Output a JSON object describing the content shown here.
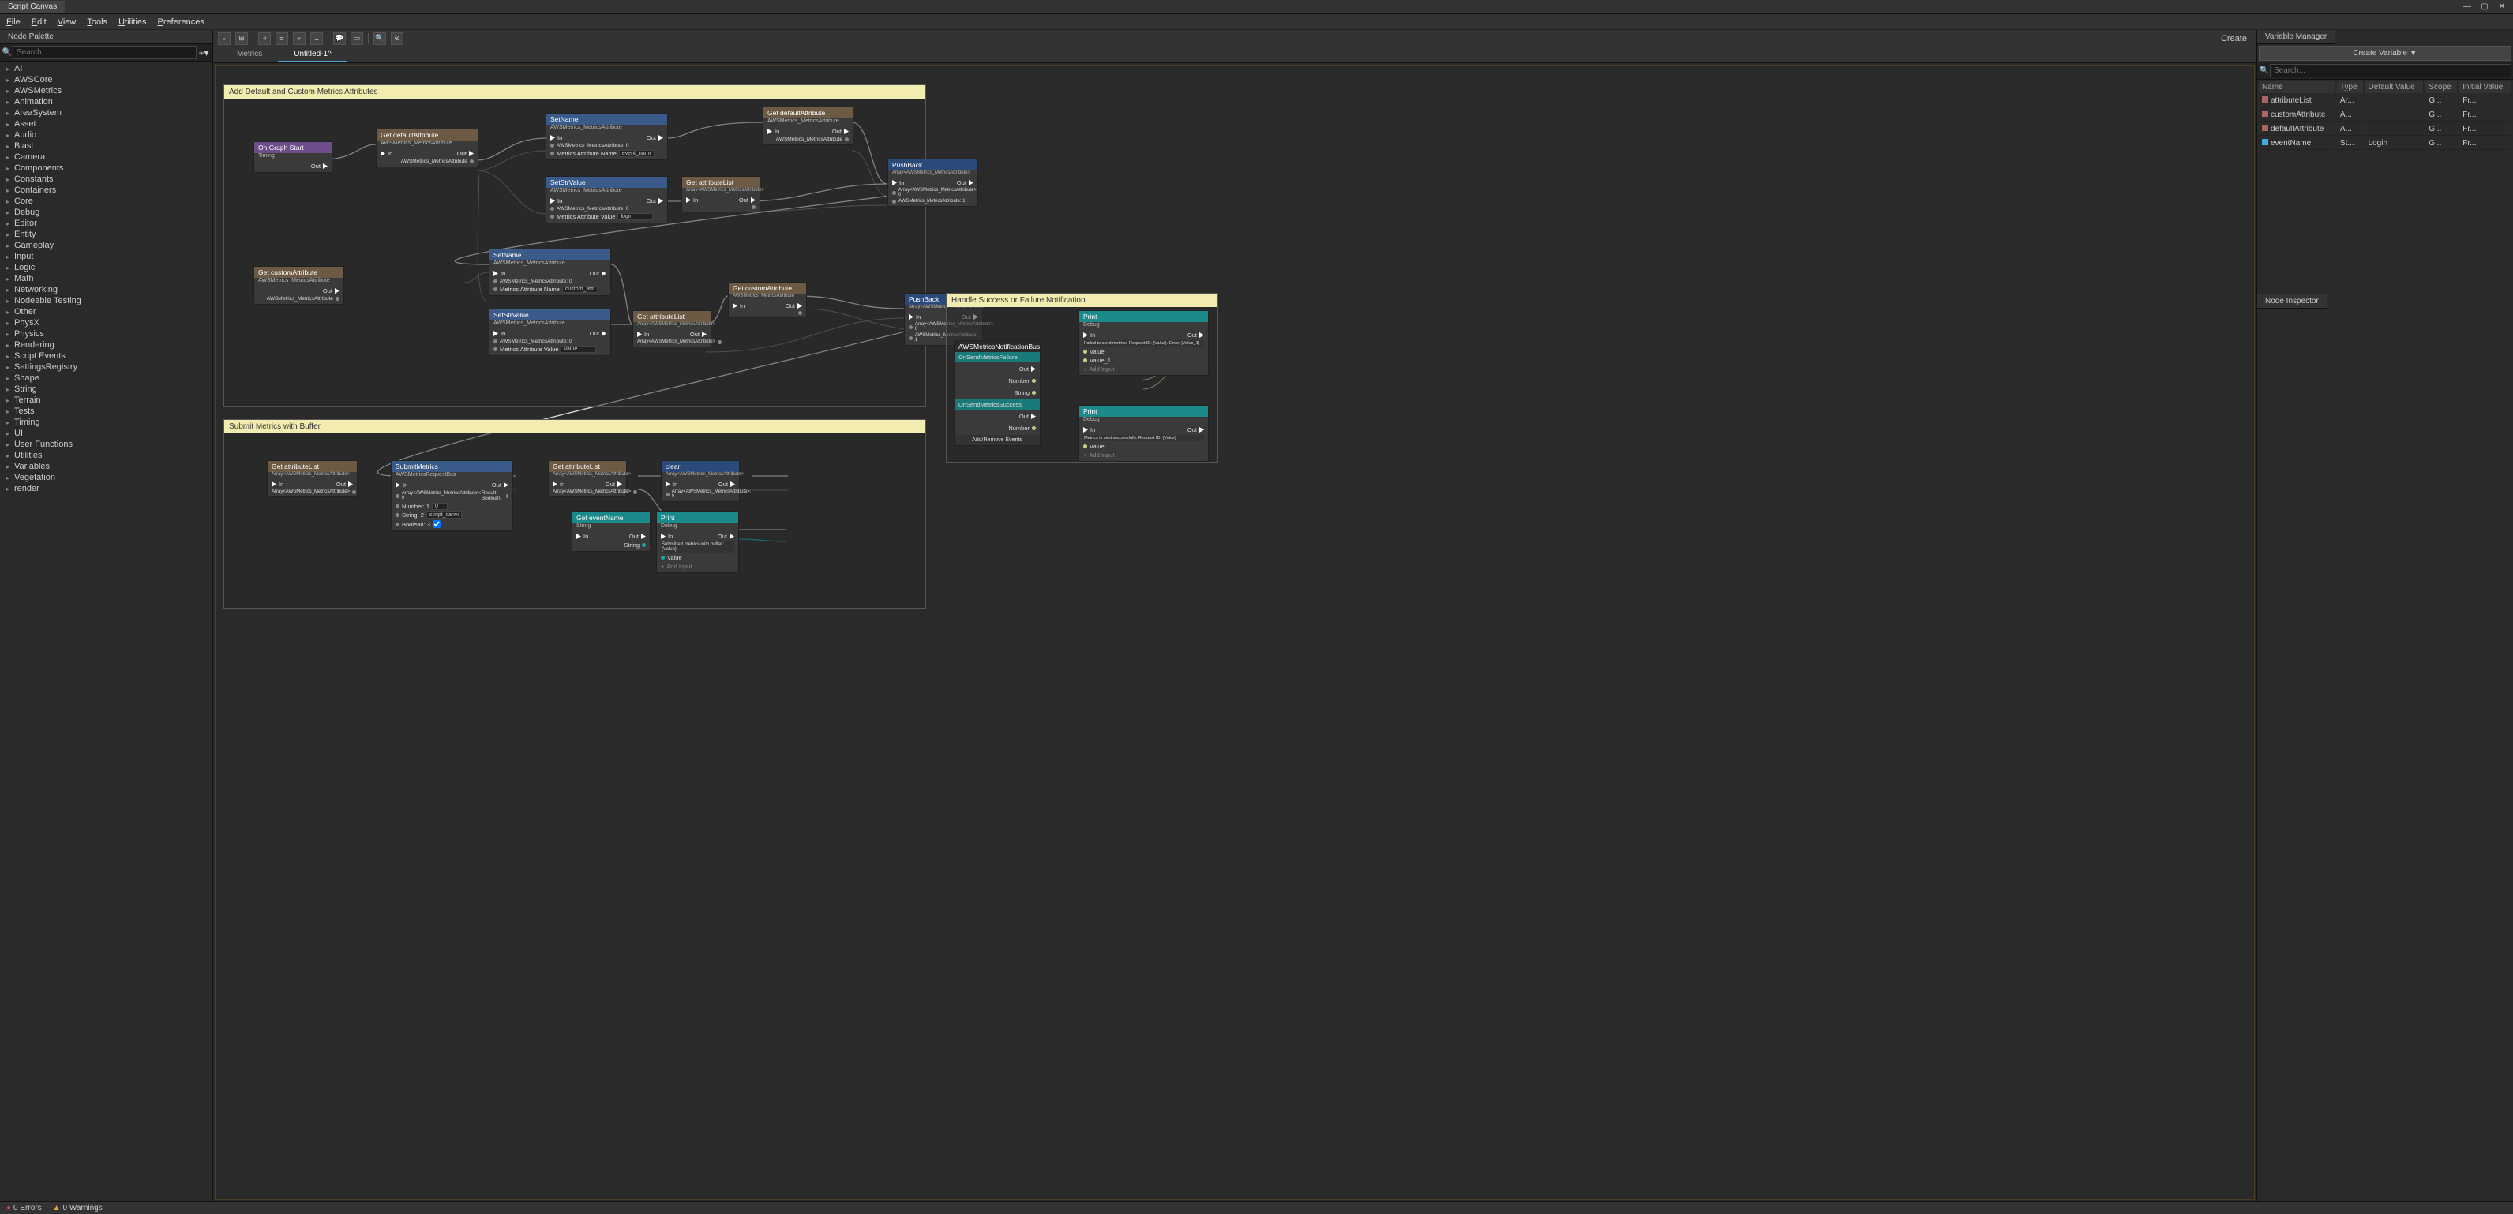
{
  "app": {
    "title": "Script Canvas"
  },
  "window_buttons": {
    "min": "—",
    "max": "▢",
    "close": "✕"
  },
  "menu": [
    "File",
    "Edit",
    "View",
    "Tools",
    "Utilities",
    "Preferences"
  ],
  "palette": {
    "title": "Node Palette",
    "search_placeholder": "Search...",
    "categories": [
      "AI",
      "AWSCore",
      "AWSMetrics",
      "Animation",
      "AreaSystem",
      "Asset",
      "Audio",
      "Blast",
      "Camera",
      "Components",
      "Constants",
      "Containers",
      "Core",
      "Debug",
      "Editor",
      "Entity",
      "Gameplay",
      "Input",
      "Logic",
      "Math",
      "Networking",
      "Nodeable Testing",
      "Other",
      "PhysX",
      "Physics",
      "Rendering",
      "Script Events",
      "SettingsRegistry",
      "Shape",
      "String",
      "Terrain",
      "Tests",
      "Timing",
      "UI",
      "User Functions",
      "Utilities",
      "Variables",
      "Vegetation",
      "render"
    ]
  },
  "toolbar": {
    "create": "Create"
  },
  "tabs": [
    {
      "label": "Metrics",
      "active": false
    },
    {
      "label": "Untitled-1^",
      "active": true
    }
  ],
  "groups": {
    "g1": {
      "title": "Add Default and Custom Metrics Attributes"
    },
    "g2": {
      "title": "Submit Metrics with Buffer"
    },
    "g3": {
      "title": "Handle Success or Failure Notification"
    }
  },
  "nodes": {
    "onstart": {
      "title": "On Graph Start",
      "sub": "Timing"
    },
    "getdef1": {
      "title": "Get defaultAttribute",
      "sub": "AWSMetrics_MetricsAttribute"
    },
    "getdef2": {
      "title": "Get defaultAttribute",
      "sub": "AWSMetrics_MetricsAttribute"
    },
    "setname1": {
      "title": "SetName",
      "sub": "AWSMetrics_MetricsAttribute",
      "field_lbl": "Metrics Attribute Name",
      "field_val": "event_name"
    },
    "setstr1": {
      "title": "SetStrValue",
      "sub": "AWSMetrics_MetricsAttribute",
      "field_lbl": "Metrics Attribute Value",
      "field_val": "login"
    },
    "getattr1": {
      "title": "Get attributeList",
      "sub": "Array<AWSMetrics_MetricsAttribute>"
    },
    "pushback1": {
      "title": "PushBack",
      "sub": "Array<AWSMetrics_MetricsAttribute>"
    },
    "getcust1": {
      "title": "Get customAttribute",
      "sub": "AWSMetrics_MetricsAttribute"
    },
    "setname2": {
      "title": "SetName",
      "sub": "AWSMetrics_MetricsAttribute",
      "field_lbl": "Metrics Attribute Name",
      "field_val": "custom_attribute"
    },
    "setstr2": {
      "title": "SetStrValue",
      "sub": "AWSMetrics_MetricsAttribute",
      "field_lbl": "Metrics Attribute Value",
      "field_val": "value"
    },
    "getattr2": {
      "title": "Get attributeList",
      "sub": "Array<AWSMetrics_MetricsAttribute>"
    },
    "getcust2": {
      "title": "Get customAttribute",
      "sub": "AWSMetrics_MetricsAttribute"
    },
    "pushback2": {
      "title": "PushBack",
      "sub": "Array<AWSMetrics_MetricsAttribute>"
    },
    "getattr3": {
      "title": "Get attributeList",
      "sub": "Array<AWSMetrics_MetricsAttribute>"
    },
    "submit": {
      "title": "SubmitMetrics",
      "sub": "AWSMetricsRequestBus",
      "num_lbl": "Number: 1",
      "num_val": "0",
      "str_lbl": "String: 2",
      "str_val": "script_canvas",
      "bool_lbl": "Boolean: 3"
    },
    "getattr4": {
      "title": "Get attributeList",
      "sub": "Array<AWSMetrics_MetricsAttribute>"
    },
    "clear": {
      "title": "clear",
      "sub": "Array<AWSMetrics_MetricsAttribute>"
    },
    "getevt": {
      "title": "Get eventName",
      "sub": "String"
    },
    "print1": {
      "title": "Print",
      "sub": "Debug",
      "msg": "Submitted metrics with buffer: {Value}"
    },
    "notif": {
      "title": "AWSMetricsNotificationBus",
      "fail": "OnSendMetricsFailure",
      "succ": "OnSendMetricsSuccess",
      "addrem": "Add/Remove Events"
    },
    "print2": {
      "title": "Print",
      "sub": "Debug",
      "msg": "Failed to send metrics. Request ID: {Value}. Error: {Value_1}"
    },
    "print3": {
      "title": "Print",
      "sub": "Debug",
      "msg": "Metrics is sent successfully. Request ID: {Value}"
    }
  },
  "ports": {
    "in": "In",
    "out": "Out",
    "result_bool": "Result: Boolean",
    "awsattr0": "AWSMetrics_MetricsAttribute: 0",
    "arrattr": "Array<AWSMetrics_MetricsAttribute>",
    "arrattr0": "Array<AWSMetrics_MetricsAttribute>: 0",
    "awsattr1": "AWSMetrics_MetricsAttribute: 1",
    "number": "Number",
    "string": "String",
    "value": "Value",
    "value1": "Value_1",
    "addinput": "Add Input"
  },
  "varmgr": {
    "title": "Variable Manager",
    "create": "Create Variable ▼",
    "search_placeholder": "Search...",
    "cols": [
      "Name",
      "Type",
      "Default Value",
      "Scope",
      "Initial Value"
    ],
    "vars": [
      {
        "name": "attributeList",
        "type": "Ar...",
        "val": "",
        "scope": "G...",
        "init": "Fr...",
        "color": "#a66"
      },
      {
        "name": "customAttribute",
        "type": "A...",
        "val": "",
        "scope": "G...",
        "init": "Fr...",
        "color": "#a66"
      },
      {
        "name": "defaultAttribute",
        "type": "A...",
        "val": "",
        "scope": "G...",
        "init": "Fr...",
        "color": "#a66"
      },
      {
        "name": "eventName",
        "type": "St...",
        "val": "Login",
        "scope": "G...",
        "init": "Fr...",
        "color": "#4ad"
      }
    ]
  },
  "inspector": {
    "title": "Node Inspector"
  },
  "status": {
    "errors": "0 Errors",
    "warnings": "0 Warnings"
  }
}
